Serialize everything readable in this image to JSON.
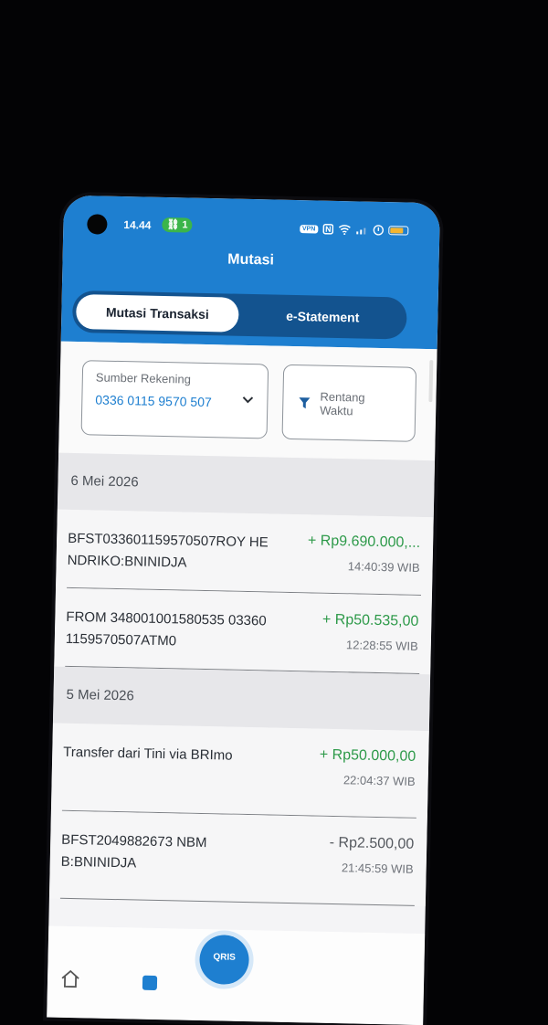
{
  "status_bar": {
    "time": "14.44",
    "sim_indicator": "1",
    "vpn_label": "VPN",
    "battery_level": 0.8,
    "battery_color": "#f4b531",
    "icons": [
      "nfc-icon",
      "wifi-icon",
      "signal-icon",
      "shield-icon",
      "battery-icon"
    ]
  },
  "header": {
    "title": "Mutasi",
    "color": "#1e7fd0"
  },
  "tabs": [
    {
      "label": "Mutasi Transaksi",
      "active": true
    },
    {
      "label": "e-Statement",
      "active": false
    }
  ],
  "filters": {
    "source_label": "Sumber Rekening",
    "source_value": "0336 0115 9570 507",
    "range_label": "Rentang Waktu"
  },
  "groups": [
    {
      "date": "6 Mei 2026",
      "transactions": [
        {
          "description": "BFST033601159570507ROY HENDRIKO:BNINIDJA",
          "amount": "+ Rp9.690.000,...",
          "time": "14:40:39 WIB",
          "type": "credit"
        },
        {
          "description": "FROM 348001001580535 033601159570507ATM0",
          "amount": "+ Rp50.535,00",
          "time": "12:28:55 WIB",
          "type": "credit"
        }
      ]
    },
    {
      "date": "5 Mei 2026",
      "transactions": [
        {
          "description": "Transfer dari Tini via BRImo",
          "amount": "+ Rp50.000,00",
          "time": "22:04:37 WIB",
          "type": "credit"
        },
        {
          "description": "BFST2049882673 NBMB:BNINIDJA",
          "amount": "- Rp2.500,00",
          "time": "21:45:59 WIB",
          "type": "debit"
        }
      ]
    }
  ],
  "bottom_nav": {
    "qris_label": "QRIS",
    "icons": [
      "home-icon",
      "mutasi-icon",
      "qris-icon"
    ]
  },
  "colors": {
    "credit": "#2e9a4a",
    "debit": "#55595f",
    "accent": "#1e7fd0"
  }
}
